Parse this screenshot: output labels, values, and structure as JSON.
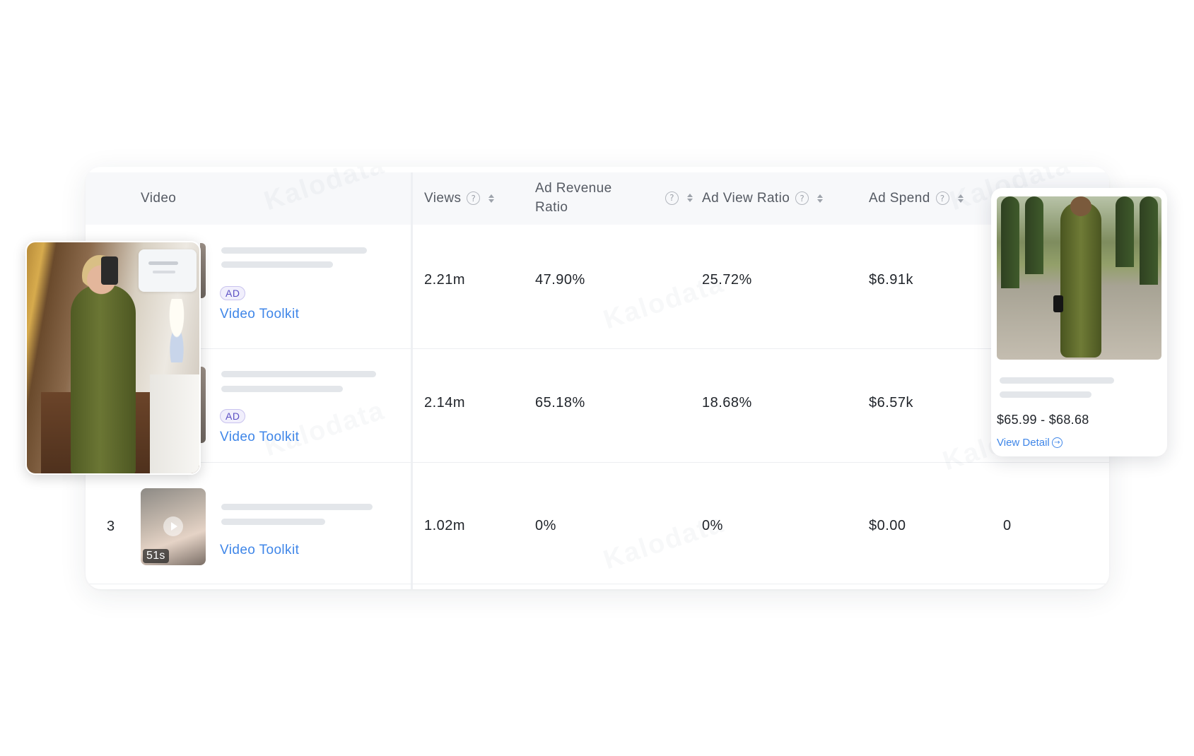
{
  "watermark": "Kalodata",
  "table": {
    "columns": {
      "video": "Video",
      "views": "Views",
      "ad_revenue_ratio_line1": "Ad Revenue",
      "ad_revenue_ratio_line2": "Ratio",
      "ad_view_ratio": "Ad View Ratio",
      "ad_spend": "Ad Spend"
    },
    "help_glyph": "?",
    "rows": [
      {
        "ad_badge": "AD",
        "toolkit": "Video Toolkit",
        "views": "2.21m",
        "ad_revenue_ratio": "47.90%",
        "ad_view_ratio": "25.72%",
        "ad_spend": "$6.91k"
      },
      {
        "ad_badge": "AD",
        "toolkit": "Video Toolkit",
        "views": "2.14m",
        "ad_revenue_ratio": "65.18%",
        "ad_view_ratio": "18.68%",
        "ad_spend": "$6.57k"
      },
      {
        "rank": "3",
        "duration": "51s",
        "toolkit": "Video Toolkit",
        "views": "1.02m",
        "ad_revenue_ratio": "0%",
        "ad_view_ratio": "0%",
        "ad_spend": "$0.00",
        "extra": "0"
      }
    ]
  },
  "product_card": {
    "price": "$65.99 - $68.68",
    "view_detail": "View Detail",
    "arrow_glyph": "→"
  },
  "colors": {
    "link": "#3f86e8",
    "ad_badge": "#5b4fc4",
    "header_bg": "#f7f8fa"
  }
}
